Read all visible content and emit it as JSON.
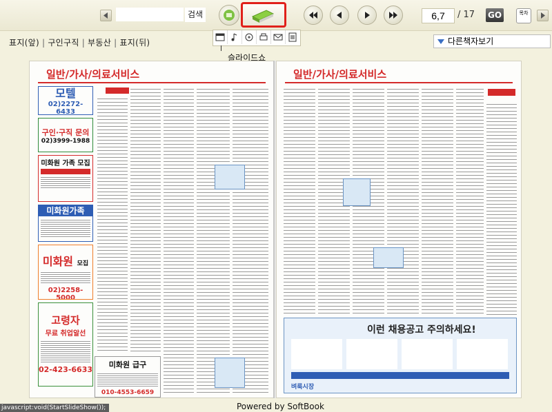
{
  "toolbar": {
    "search_button": "검색",
    "search_value": "",
    "page_value": "6,7",
    "total_pages": "/ 17",
    "go_label": "GO",
    "menu_glyph": "목차"
  },
  "nav": {
    "links": [
      "표지(앞)",
      "구인구직",
      "부동산",
      "표지(뒤)"
    ],
    "separator": "|"
  },
  "slideshow_tooltip": "슬라이드쇼",
  "other_books_label": "다른책자보기",
  "book": {
    "left_header": "일반/가사/의료서비스",
    "right_header": "일반/가사/의료서비스",
    "left_ads": {
      "motel": "모텔",
      "motel_phone": "02)2272-6433",
      "recruit_title": "구인·구직 문의",
      "recruit_phone": "02)3999-1988",
      "mihwawon_family": "미화원 가족 모집",
      "mihwawon_family2": "미화원가족",
      "mihwawon": "미화원",
      "mihwawon_sub": "모집",
      "mihwawon_phone": "02)2258-5000",
      "senior": "고령자",
      "senior_sub": "무료 취업알선",
      "senior_phone": "02-423-6633",
      "urgent": "미화원 급구",
      "urgent_phone": "010-4553-6659"
    },
    "right_banner": {
      "headline": "이런 채용공고 주의하세요!",
      "market": "벼룩시장"
    }
  },
  "status_bar": "javascript:void(StartSlideShow());",
  "powered_by": "Powered by SoftBook"
}
